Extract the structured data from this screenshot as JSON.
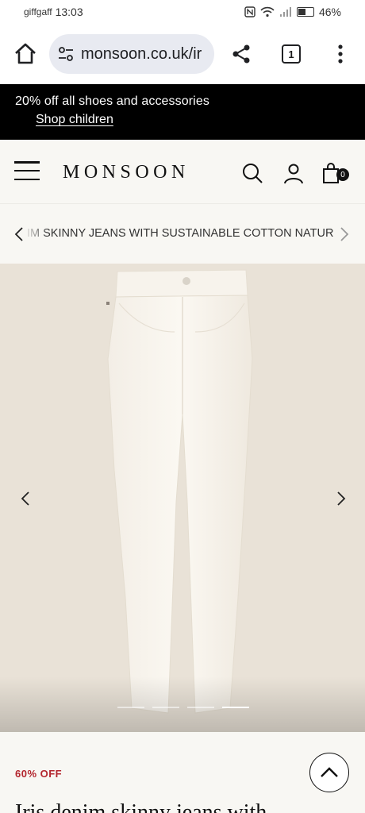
{
  "status_bar": {
    "carrier": "giffgaff",
    "time": "13:03",
    "battery": "46%"
  },
  "browser": {
    "url": "monsoon.co.uk/ir",
    "tab_count": "1"
  },
  "promo": {
    "text": "20% off all shoes and accessories",
    "link": "Shop children"
  },
  "header": {
    "logo": "MONSOON",
    "bag_count": "0"
  },
  "breadcrumb": {
    "text": "IM SKINNY JEANS WITH SUSTAINABLE COTTON NATURAL"
  },
  "gallery": {
    "image_count": 4,
    "active_index": 3
  },
  "product": {
    "discount": "60% OFF",
    "title": "Iris denim skinny jeans with"
  },
  "colors": {
    "promo_bg": "#000000",
    "page_bg": "#f8f7f3",
    "gallery_bg": "#e9e2d7",
    "sale_red": "#b3262e"
  }
}
